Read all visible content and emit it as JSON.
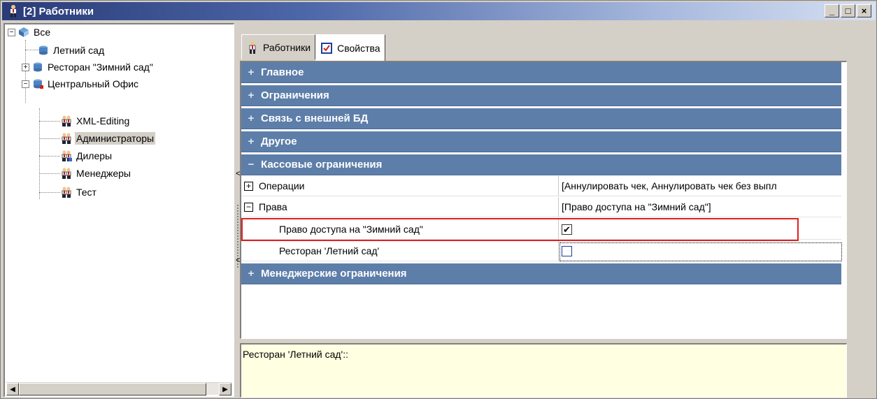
{
  "window": {
    "title": "[2] Работники",
    "buttons": {
      "minimize": "_",
      "maximize": "□",
      "close": "×"
    }
  },
  "tree": {
    "root": {
      "label": "Все",
      "expander": "−"
    },
    "items": [
      {
        "label": "Летний сад",
        "expander": ""
      },
      {
        "label": "Ресторан \"Зимний сад\"",
        "expander": "+"
      },
      {
        "label": "Центральный Офис",
        "expander": "−"
      }
    ],
    "groups": [
      {
        "label": "XML-Editing"
      },
      {
        "label": "Администраторы",
        "selected": true
      },
      {
        "label": "Дилеры"
      },
      {
        "label": "Менеджеры"
      },
      {
        "label": "Тест"
      }
    ],
    "scroll": {
      "left": "◀",
      "right": "▶"
    }
  },
  "splitter": {
    "arrow": "<"
  },
  "tabs": [
    {
      "label": "Работники",
      "icon": "person-icon"
    },
    {
      "label": "Свойства",
      "icon": "properties-checkbox-icon",
      "active": true
    }
  ],
  "grid": {
    "categories": {
      "main": {
        "label": "Главное",
        "expander": "+"
      },
      "limits": {
        "label": "Ограничения",
        "expander": "+"
      },
      "extdb": {
        "label": "Связь с внешней БД",
        "expander": "+"
      },
      "other": {
        "label": "Другое",
        "expander": "+"
      },
      "cash": {
        "label": "Кассовые ограничения",
        "expander": "−"
      },
      "manager": {
        "label": "Менеджерские ограничения",
        "expander": "+"
      }
    },
    "rows": {
      "operations": {
        "name": "Операции",
        "expander": "+",
        "value": "[Аннулировать чек, Аннулировать чек без выпл"
      },
      "rights": {
        "name": "Права",
        "expander": "−",
        "value": "[Право доступа на \"Зимний сад\"]"
      },
      "winter": {
        "name": "Право доступа на \"Зимний сад\"",
        "checked": true,
        "check": "✔"
      },
      "summer": {
        "name": "Ресторан 'Летний сад'",
        "checked": false,
        "check": ""
      }
    }
  },
  "description": {
    "text": "Ресторан 'Летний сад'::"
  },
  "colors": {
    "category": "#5d7ea9",
    "highlight": "#e02020",
    "description_bg": "#ffffe1"
  }
}
